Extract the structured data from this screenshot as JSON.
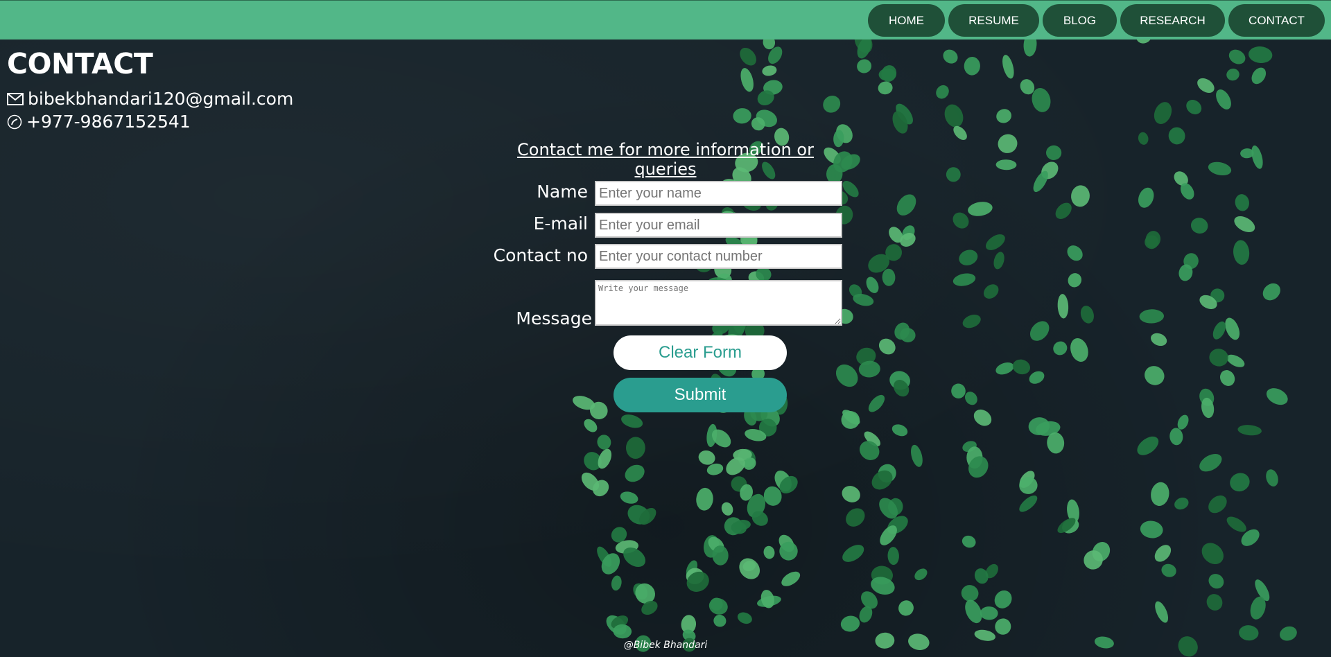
{
  "nav": {
    "items": [
      {
        "label": "HOME"
      },
      {
        "label": "RESUME"
      },
      {
        "label": "BLOG"
      },
      {
        "label": "RESEARCH"
      },
      {
        "label": "CONTACT"
      }
    ]
  },
  "header": {
    "title": "CONTACT",
    "email": "bibekbhandari120@gmail.com",
    "phone": "+977-9867152541"
  },
  "form": {
    "heading": "Contact me for more information or queries",
    "name_label": "Name",
    "name_placeholder": "Enter your name",
    "email_label": "E-mail",
    "email_placeholder": "Enter your email",
    "contact_label": "Contact no",
    "contact_placeholder": "Enter your contact number",
    "message_label": "Message",
    "message_placeholder": "Write your message",
    "clear_label": "Clear Form",
    "submit_label": "Submit"
  },
  "footer": {
    "credit": "@Bibek Bhandari"
  },
  "colors": {
    "navbar": "#52b788",
    "nav_button": "#1f5038",
    "background": "#17232a",
    "accent": "#2a9d8f",
    "leaf": "#2d8a4e"
  },
  "icons": {
    "email": "envelope-icon",
    "phone": "phone-icon"
  }
}
